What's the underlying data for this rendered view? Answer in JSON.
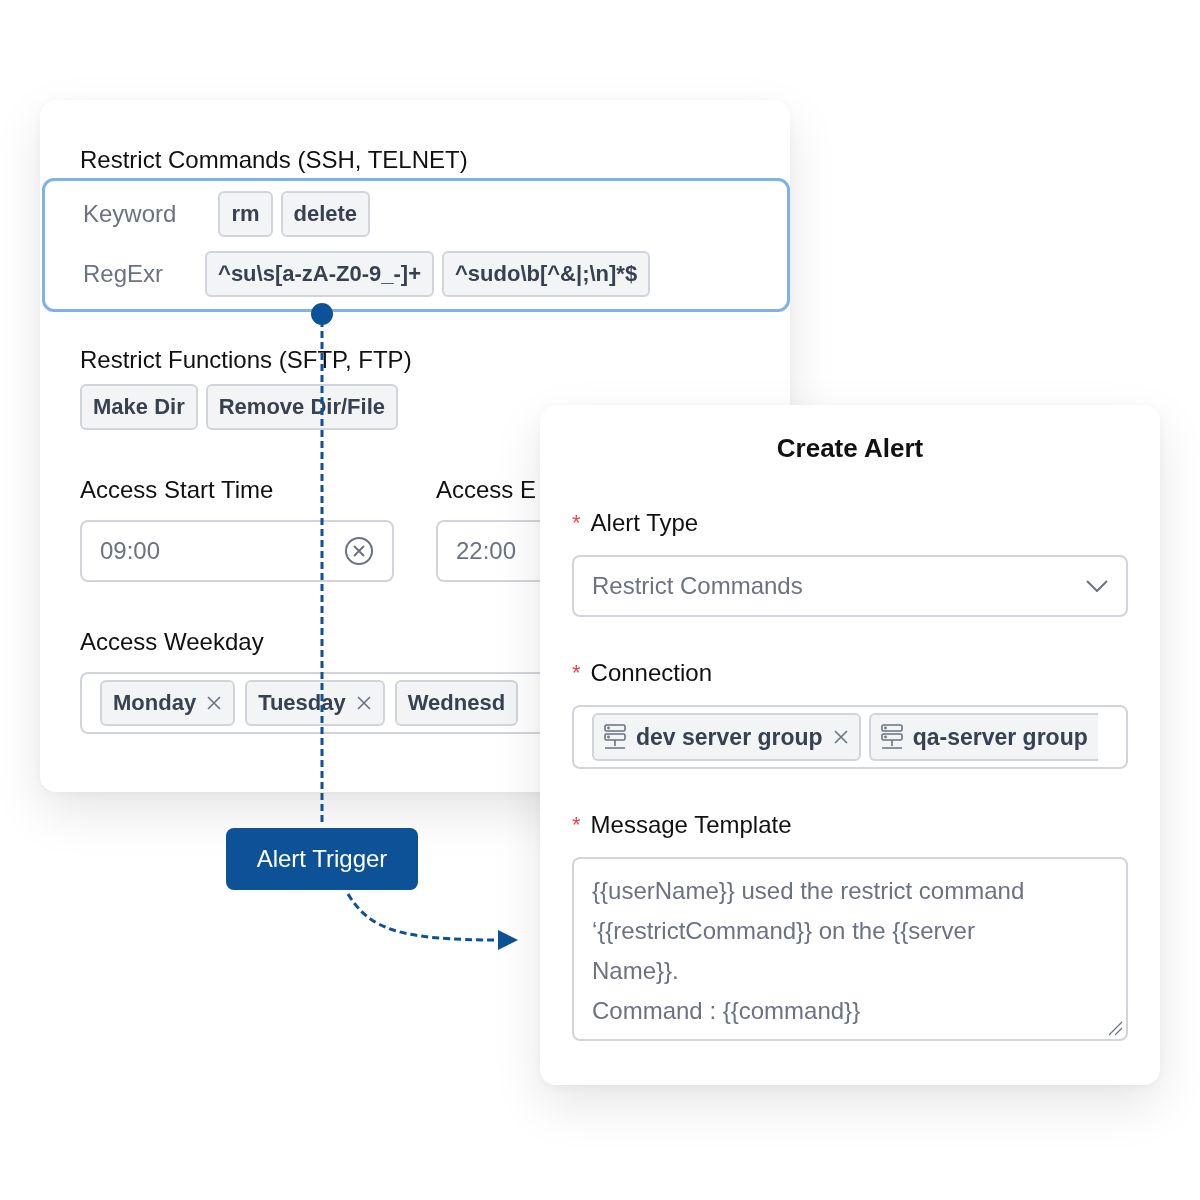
{
  "rules_card": {
    "commands_title": "Restrict Commands (SSH, TELNET)",
    "commands_box": {
      "highlighted": true,
      "rows": [
        {
          "label": "Keyword",
          "tags": [
            "rm",
            "delete"
          ]
        },
        {
          "label": "RegExr",
          "tags": [
            "^su\\s[a-zA-Z0-9_-]+",
            "^sudo\\b[^&|;\\n]*$"
          ]
        }
      ]
    },
    "functions_title": "Restrict Functions (SFTP, FTP)",
    "functions": [
      "Make Dir",
      "Remove Dir/File"
    ],
    "start_time": {
      "label": "Access Start Time",
      "value": "09:00"
    },
    "end_time": {
      "label": "Access E",
      "value": "22:00"
    },
    "weekday": {
      "label": "Access Weekday",
      "tags": [
        {
          "label": "Monday",
          "removable": true
        },
        {
          "label": "Tuesday",
          "removable": true
        },
        {
          "label": "Wednesd",
          "removable": false
        }
      ]
    }
  },
  "trigger_button": "Alert Trigger",
  "alert_dialog": {
    "title": "Create Alert",
    "alert_type": {
      "label": "Alert Type",
      "required_mark": "*",
      "value": "Restrict Commands"
    },
    "connection": {
      "label": "Connection",
      "required_mark": "*",
      "tags": [
        {
          "label": "dev server group",
          "removable": true
        },
        {
          "label": "qa-server group",
          "removable": false
        }
      ]
    },
    "message": {
      "label": "Message Template",
      "required_mark": "*",
      "value": "{{userName}} used the restrict command ‘{{restrictCommand}} on the {{server Name}}.\nCommand : {{command}}"
    }
  }
}
